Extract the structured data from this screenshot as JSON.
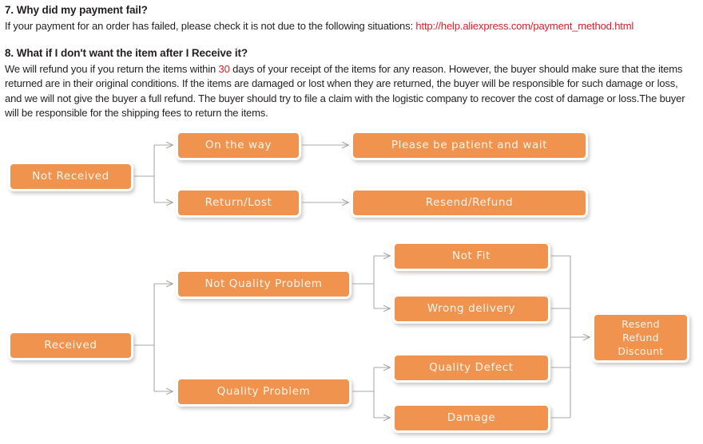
{
  "faq": [
    {
      "number": "7.",
      "heading": "7. Why did my payment fail?",
      "body_before": "If your payment for an order has failed, please check it is not due to the following  situations: ",
      "link_text": "http://help.aliexpress.com/payment_method.html",
      "body_after": ""
    },
    {
      "number": "8.",
      "heading": "8. What if I don't want the item after I Receive it?",
      "body_part1": "We will refund you if you return the items within ",
      "highlight": "30",
      "body_part2": " days of your receipt of the items for any reason. However, the buyer should make sure that the items returned are in their original conditions.  If the items are damaged or lost when they are returned, the buyer will be responsible for such damage or loss, and we will not give the buyer a full refund.  The buyer should try to file a claim with the logistic company to recover the cost of damage or loss.The buyer will be responsible for the shipping fees to return the items."
    }
  ],
  "colors": {
    "node_fill": "#f0934e",
    "node_text": "#fdf5ec",
    "link": "#d81f26",
    "connector": "#a8a8a8",
    "page_bg": "#ffffff"
  },
  "flowchart_not_received": {
    "title": "Not Received flow",
    "nodes": [
      {
        "id": "not-received",
        "label": "Not Received"
      },
      {
        "id": "on-the-way",
        "label": "On the way"
      },
      {
        "id": "return-lost",
        "label": "Return/Lost"
      },
      {
        "id": "please-be-patient-and-wait",
        "label": "Please be patient and wait"
      },
      {
        "id": "resend-refund",
        "label": "Resend/Refund"
      }
    ],
    "edges": [
      {
        "from": "not-received",
        "to": "on-the-way"
      },
      {
        "from": "not-received",
        "to": "return-lost"
      },
      {
        "from": "on-the-way",
        "to": "please-be-patient-and-wait"
      },
      {
        "from": "return-lost",
        "to": "resend-refund"
      }
    ]
  },
  "flowchart_received": {
    "title": "Received flow",
    "nodes": [
      {
        "id": "received",
        "label": "Received"
      },
      {
        "id": "not-quality-problem",
        "label": "Not Quality Problem"
      },
      {
        "id": "quality-problem",
        "label": "Quality Problem"
      },
      {
        "id": "not-fit",
        "label": "Not Fit"
      },
      {
        "id": "wrong-delivery",
        "label": "Wrong delivery"
      },
      {
        "id": "quality-defect",
        "label": "Quality Defect"
      },
      {
        "id": "damage",
        "label": "Damage"
      },
      {
        "id": "resend-refund-discount",
        "label": "Resend\nRefund\nDiscount"
      }
    ],
    "edges": [
      {
        "from": "received",
        "to": "not-quality-problem"
      },
      {
        "from": "received",
        "to": "quality-problem"
      },
      {
        "from": "not-quality-problem",
        "to": "not-fit"
      },
      {
        "from": "not-quality-problem",
        "to": "wrong-delivery"
      },
      {
        "from": "quality-problem",
        "to": "quality-defect"
      },
      {
        "from": "quality-problem",
        "to": "damage"
      },
      {
        "from": "not-fit",
        "to": "resend-refund-discount"
      },
      {
        "from": "wrong-delivery",
        "to": "resend-refund-discount"
      },
      {
        "from": "quality-defect",
        "to": "resend-refund-discount"
      },
      {
        "from": "damage",
        "to": "resend-refund-discount"
      }
    ]
  }
}
